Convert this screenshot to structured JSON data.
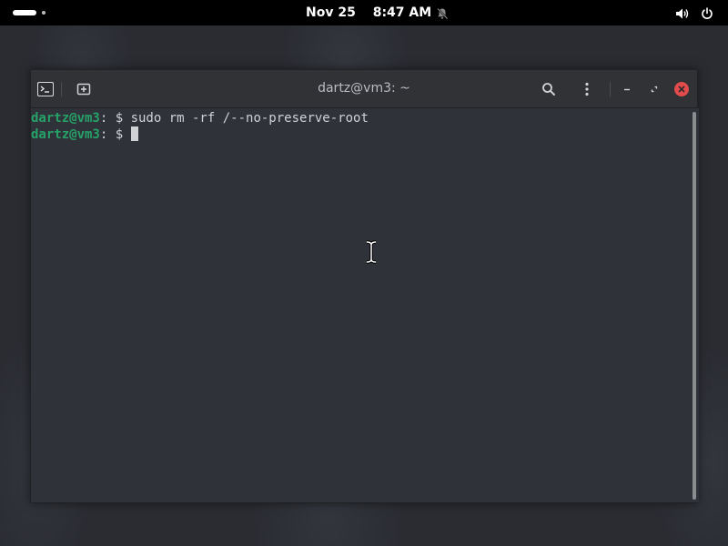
{
  "topbar": {
    "date": "Nov 25",
    "time": "8:47 AM",
    "icons": [
      "activities-indicator",
      "dnd-bell-off-icon",
      "volume-icon",
      "power-icon"
    ]
  },
  "window": {
    "title": "dartz@vm3: ~",
    "icons": [
      "terminal-icon",
      "new-tab-icon",
      "search-icon",
      "menu-dots-icon",
      "minimize-icon",
      "restore-icon",
      "close-icon"
    ],
    "accent_close": "#e24b4b"
  },
  "terminal": {
    "lines": [
      {
        "user_host": "dartz@vm3",
        "sep": ": $ ",
        "command": "sudo rm -rf /--no-preserve-root"
      },
      {
        "user_host": "dartz@vm3",
        "sep": ": $ ",
        "command": ""
      }
    ],
    "prompt_color": "#26a269"
  }
}
